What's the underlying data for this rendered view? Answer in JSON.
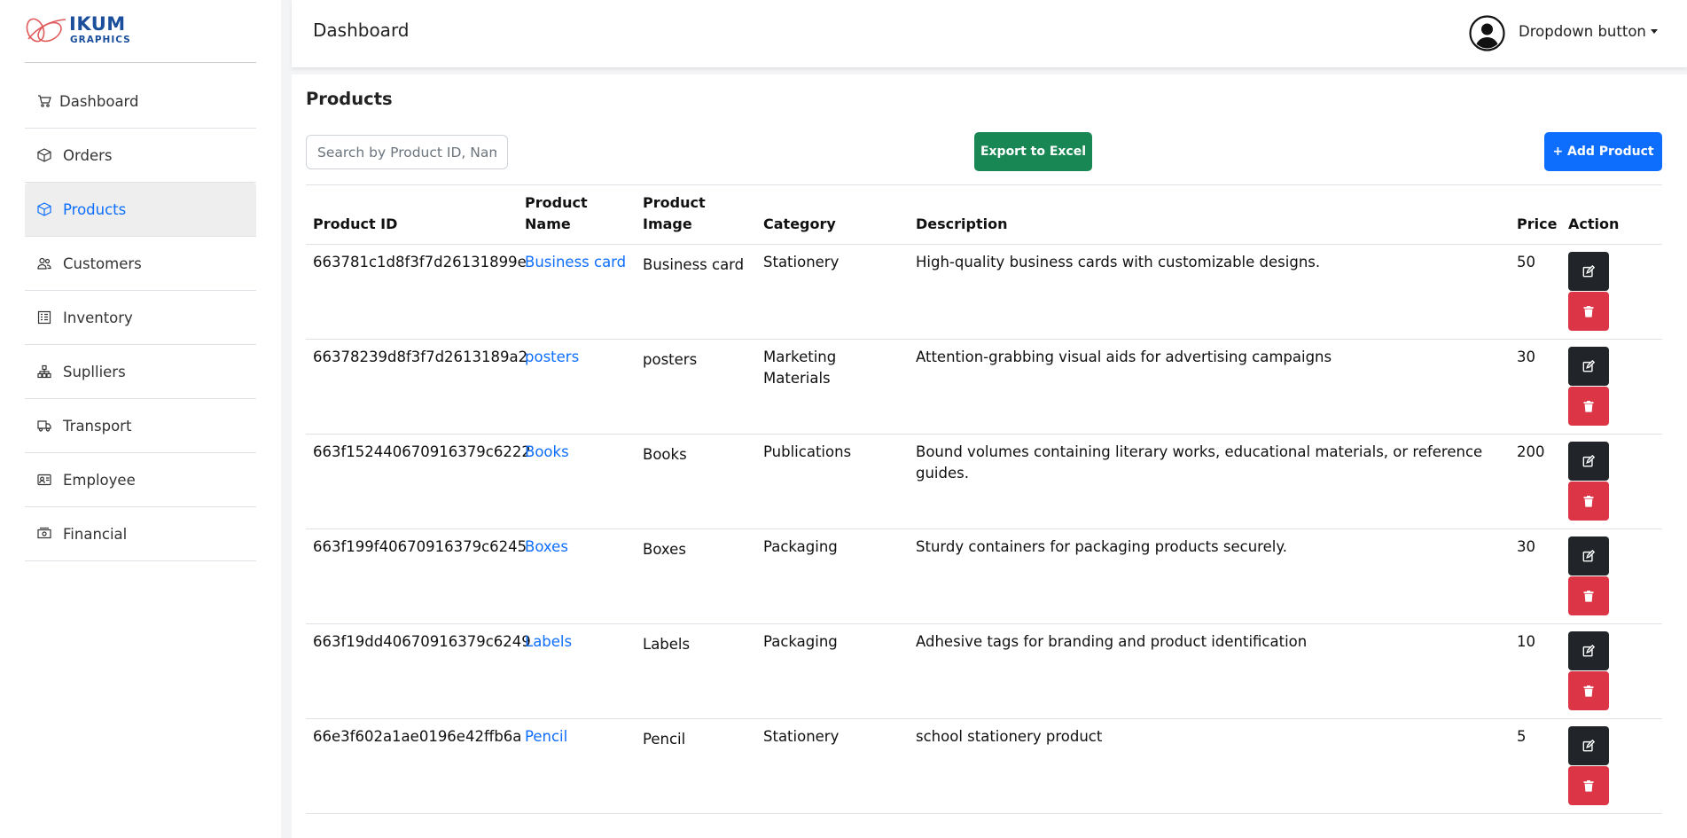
{
  "brand": {
    "name": "IKUM",
    "sub": "GRAPHICS",
    "accent": "#1b4f9c",
    "logo_mark_color": "#e05a5a"
  },
  "sidebar": {
    "items": [
      {
        "label": "Dashboard",
        "icon": "cart-icon",
        "active": false
      },
      {
        "label": "Orders",
        "icon": "box-icon",
        "active": false
      },
      {
        "label": "Products",
        "icon": "box-icon",
        "active": true
      },
      {
        "label": "Customers",
        "icon": "people-icon",
        "active": false
      },
      {
        "label": "Inventory",
        "icon": "list-icon",
        "active": false
      },
      {
        "label": "Suplliers",
        "icon": "network-icon",
        "active": false
      },
      {
        "label": "Transport",
        "icon": "truck-icon",
        "active": false
      },
      {
        "label": "Employee",
        "icon": "person-card-icon",
        "active": false
      },
      {
        "label": "Financial",
        "icon": "cash-icon",
        "active": false
      }
    ]
  },
  "header": {
    "title": "Dashboard",
    "dropdown_label": "Dropdown button"
  },
  "main": {
    "title": "Products",
    "search_placeholder": "Search by Product ID, Name...",
    "export_label": "Export to Excel",
    "add_label": "+ Add Product",
    "table": {
      "columns": [
        "Product ID",
        "Product Name",
        "Product Image",
        "Category",
        "Description",
        "Price",
        "Action"
      ],
      "rows": [
        {
          "id": "663781c1d8f3f7d26131899e",
          "name": "Business card",
          "image_alt": "Business card",
          "category": "Stationery",
          "description": "High-quality business cards with customizable designs.",
          "price": "50"
        },
        {
          "id": "66378239d8f3f7d2613189a2",
          "name": "posters",
          "image_alt": "posters",
          "category": "Marketing Materials",
          "description": "Attention-grabbing visual aids for advertising campaigns",
          "price": "30"
        },
        {
          "id": "663f152440670916379c6222",
          "name": "Books",
          "image_alt": "Books",
          "category": "Publications",
          "description": "Bound volumes containing literary works, educational materials, or reference guides.",
          "price": "200"
        },
        {
          "id": "663f199f40670916379c6245",
          "name": "Boxes",
          "image_alt": "Boxes",
          "category": "Packaging",
          "description": "Sturdy containers for packaging products securely.",
          "price": "30"
        },
        {
          "id": "663f19dd40670916379c6249",
          "name": "Labels",
          "image_alt": "Labels",
          "category": "Packaging",
          "description": "Adhesive tags for branding and product identification",
          "price": "10"
        },
        {
          "id": "66e3f602a1ae0196e42ffb6a",
          "name": "Pencil",
          "image_alt": "Pencil",
          "category": "Stationery",
          "description": "school stationery product",
          "price": "5"
        }
      ]
    }
  },
  "colors": {
    "primary": "#0d6efd",
    "success": "#198754",
    "danger": "#dc3545",
    "dark": "#212529",
    "active_bg": "#eeeeee"
  }
}
